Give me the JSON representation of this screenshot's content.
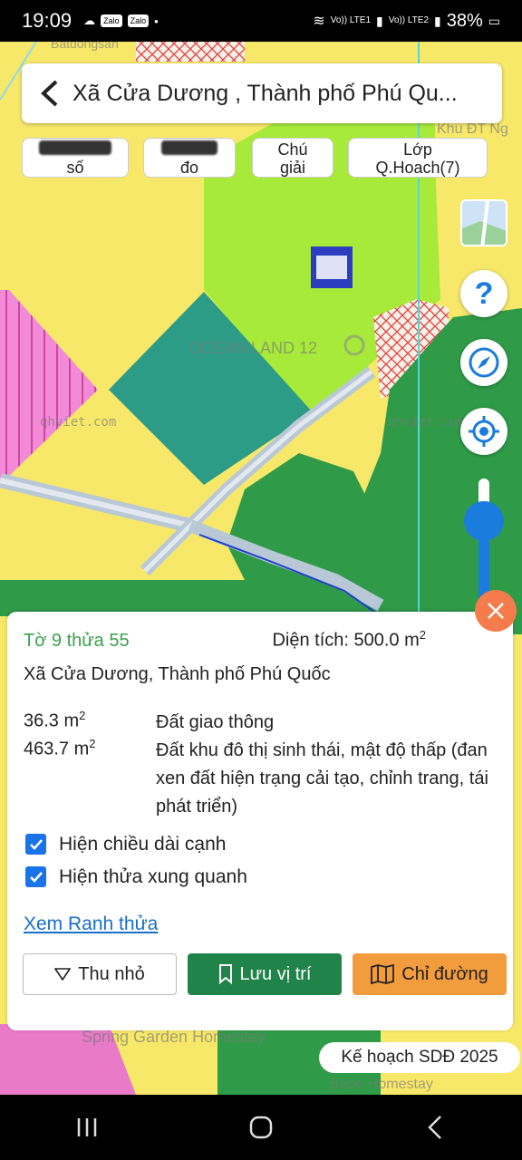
{
  "status_bar": {
    "time": "19:09",
    "notif_icons": [
      "cloud-icon",
      "zalo-icon",
      "zalo-icon",
      "dot-icon"
    ],
    "zalo_label": "Zalo",
    "sim1": "Vo)) LTE1",
    "sim2": "Vo)) LTE2",
    "battery": "38%"
  },
  "header": {
    "title": "Xã Cửa Dương , Thành phố Phú Qu..."
  },
  "tools": {
    "check_number_label_line2": "số",
    "measure_label_line2": "đo",
    "legend_label": "Chú giải",
    "planning_layer_label": "Lớp Q.Hoach(7)"
  },
  "map_labels": {
    "ocean_land": "OCEAN LAND 12",
    "watermark_left": "qhviet.com",
    "watermark_right": "qhviet.com",
    "watermark_top": "Batdongsan",
    "khu_dt": "Khu ĐT Ng",
    "homestay": "Spring Garden Homestay",
    "bebe": "Bebe Homestay"
  },
  "panel": {
    "parcel_id": "Tờ 9 thửa 55",
    "area_label": "Diện tích: 500.0 m",
    "area_sup": "2",
    "address": "Xã Cửa Dương, Thành phố Phú Quốc",
    "land_uses": [
      {
        "area": "36.3 m",
        "sup": "2",
        "desc": "Đất giao thông"
      },
      {
        "area": "463.7 m",
        "sup": "2",
        "desc": "Đất khu đô thị sinh thái, mật độ thấp (đan xen đất hiện trạng cải tạo, chỉnh trang, tái phát triển)"
      }
    ],
    "checkbox_edge_length": "Hiện chiều dài cạnh",
    "checkbox_neighbors": "Hiện thửa xung quanh",
    "view_boundary_link": "Xem Ranh thửa",
    "collapse_button": "Thu nhỏ",
    "save_location_button": "Lưu vị trí",
    "directions_button": "Chỉ đường"
  },
  "plan_badge": "Kế hoạch SDĐ 2025",
  "colors": {
    "residential_yellow": "#f7e86a",
    "green_zone": "#a8ea3a",
    "teal_parcel": "#2c9c86",
    "forest_green": "#2f9b48",
    "pink_zone": "#f28ad8",
    "accent_green": "#20844a",
    "accent_orange": "#f39c3d",
    "accent_blue": "#1a73e8"
  }
}
